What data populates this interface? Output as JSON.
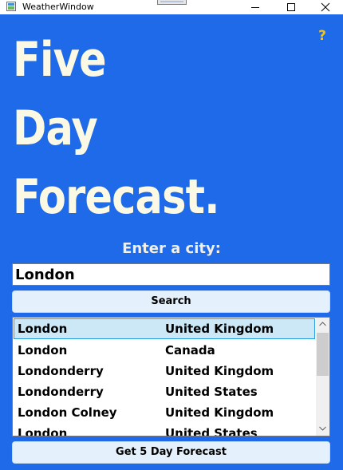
{
  "window": {
    "title": "WeatherWindow"
  },
  "heading": {
    "line1": "Five",
    "line2": "Day",
    "line3": "Forecast."
  },
  "help": {
    "icon": "question-mark-icon",
    "glyph": "?"
  },
  "prompt": "Enter a city:",
  "search": {
    "value": "London",
    "button_label": "Search"
  },
  "results": [
    {
      "city": "London",
      "country": "United Kingdom",
      "selected": true
    },
    {
      "city": "London",
      "country": "Canada",
      "selected": false
    },
    {
      "city": "Londonderry",
      "country": "United Kingdom",
      "selected": false
    },
    {
      "city": "Londonderry",
      "country": "United States",
      "selected": false
    },
    {
      "city": "London Colney",
      "country": "United Kingdom",
      "selected": false
    },
    {
      "city": "London",
      "country": "United States",
      "selected": false
    }
  ],
  "forecast_button_label": "Get 5 Day Forecast",
  "colors": {
    "background": "#1e6ae8",
    "heading_text": "#fbf8e4",
    "button": "#e4f1fc",
    "selection": "#cce8f6",
    "help_icon": "#f3c21a"
  }
}
